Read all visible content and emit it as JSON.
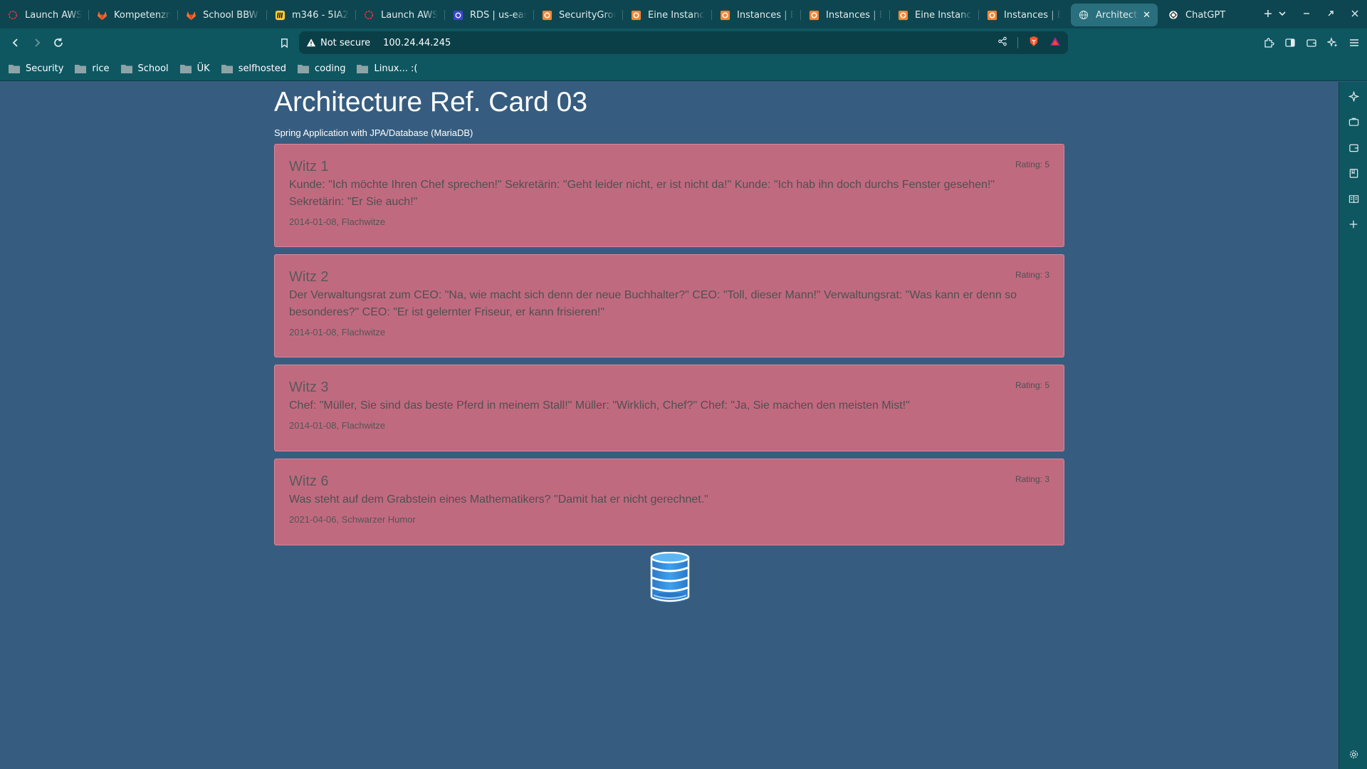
{
  "browser": {
    "tabs": [
      {
        "title": "Launch AWS",
        "favicon": "aws-academy-icon",
        "active": false
      },
      {
        "title": "Kompetenzm",
        "favicon": "gitlab-icon",
        "active": false
      },
      {
        "title": "School BBW",
        "favicon": "gitlab-icon",
        "active": false
      },
      {
        "title": "m346 - 5IA23",
        "favicon": "miro-icon",
        "active": false
      },
      {
        "title": "Launch AWS",
        "favicon": "aws-academy-icon",
        "active": false
      },
      {
        "title": "RDS | us-eas",
        "favicon": "aws-rds-icon",
        "active": false
      },
      {
        "title": "SecurityGrou",
        "favicon": "aws-icon",
        "active": false
      },
      {
        "title": "Eine Instanc",
        "favicon": "aws-icon",
        "active": false
      },
      {
        "title": "Instances | E",
        "favicon": "aws-icon",
        "active": false
      },
      {
        "title": "Instances | E",
        "favicon": "aws-icon",
        "active": false
      },
      {
        "title": "Eine Instanc",
        "favicon": "aws-icon",
        "active": false
      },
      {
        "title": "Instances | E",
        "favicon": "aws-icon",
        "active": false
      },
      {
        "title": "Architect",
        "favicon": "globe-icon",
        "active": true
      },
      {
        "title": "ChatGPT",
        "favicon": "chatgpt-icon",
        "active": false
      }
    ],
    "security_label": "Not secure",
    "url": "100.24.44.245",
    "bookmarks": [
      "Security",
      "rice",
      "School",
      "ÜK",
      "selfhosted",
      "coding",
      "Linux... :("
    ],
    "colors": {
      "tab_bar": "#0d4650",
      "toolbar": "#0e5761",
      "active_tab": "#2a6f7d"
    }
  },
  "page": {
    "title": "Architecture Ref. Card 03",
    "subtitle": "Spring Application with JPA/Database (MariaDB)",
    "cards": [
      {
        "title": "Witz 1",
        "rating": "Rating: 5",
        "text": "Kunde: \"Ich möchte Ihren Chef sprechen!\" Sekretärin: \"Geht leider nicht, er ist nicht da!\" Kunde: \"Ich hab ihn doch durchs Fenster gesehen!\" Sekretärin: \"Er Sie auch!\"",
        "date": "2014-01-08",
        "category": "Flachwitze"
      },
      {
        "title": "Witz 2",
        "rating": "Rating: 3",
        "text": "Der Verwaltungsrat zum CEO: \"Na, wie macht sich denn der neue Buchhalter?\" CEO: \"Toll, dieser Mann!\" Verwaltungsrat: \"Was kann er denn so besonderes?\" CEO: \"Er ist gelernter Friseur, er kann frisieren!\"",
        "date": "2014-01-08",
        "category": "Flachwitze"
      },
      {
        "title": "Witz 3",
        "rating": "Rating: 5",
        "text": "Chef: \"Müller, Sie sind das beste Pferd in meinem Stall!\" Müller: \"Wirklich, Chef?\" Chef: \"Ja, Sie machen den meisten Mist!\"",
        "date": "2014-01-08",
        "category": "Flachwitze"
      },
      {
        "title": "Witz 6",
        "rating": "Rating: 3",
        "text": "Was steht auf dem Grabstein eines Mathematikers? \"Damit hat er nicht gerechnet.\"",
        "date": "2021-04-06",
        "category": "Schwarzer Humor"
      }
    ],
    "colors": {
      "background": "#365d7f",
      "card": "#c06a80",
      "db_icon": "#2d8cdc"
    }
  }
}
